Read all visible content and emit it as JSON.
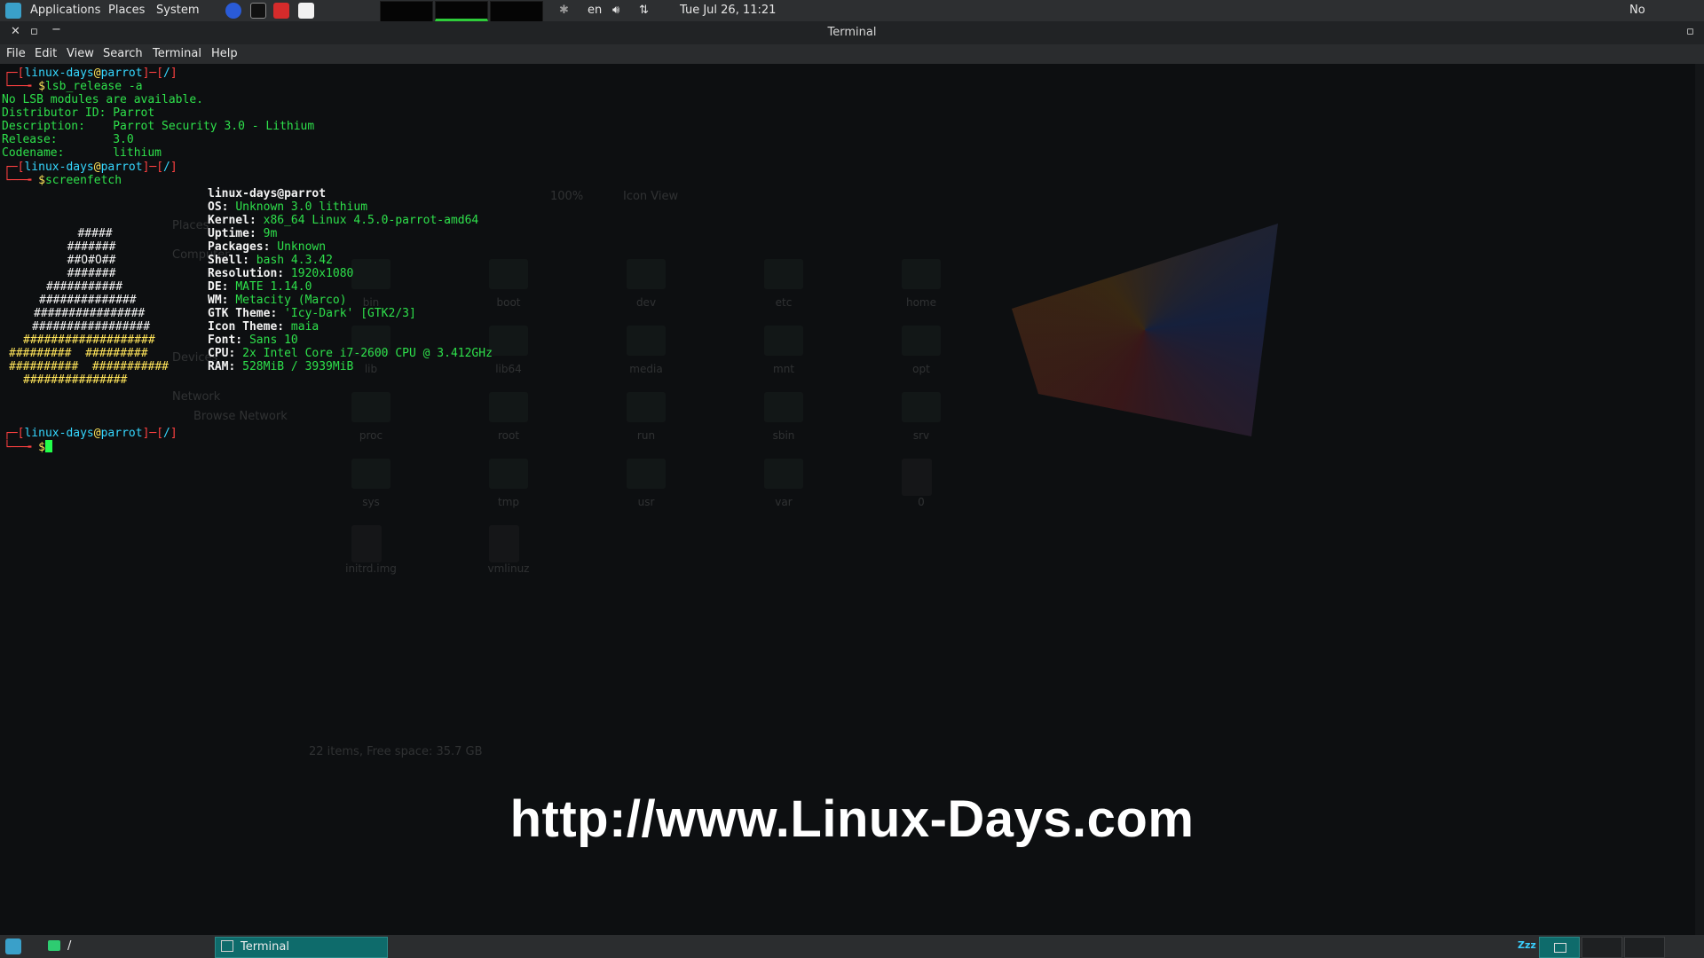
{
  "topbar": {
    "menus": [
      "Applications",
      "Places",
      "System"
    ],
    "lang": "en",
    "datetime": "Tue Jul 26, 11:21",
    "indicators": "No Indicators",
    "launchers": [
      "firefox-icon",
      "terminal-icon",
      "screenshot-icon",
      "text-editor-icon"
    ],
    "bluetooth_icon": "bluetooth-icon",
    "volume_icon": "volume-icon",
    "network_icon": "network-updown-icon"
  },
  "window": {
    "title": "Terminal",
    "menu": [
      "File",
      "Edit",
      "View",
      "Search",
      "Terminal",
      "Help"
    ]
  },
  "terminal": {
    "user": "linux-days",
    "host": "parrot",
    "path": "/",
    "cmd1": "lsb_release -a",
    "lsb_lines": [
      "No LSB modules are available.",
      "Distributor ID: Parrot",
      "Description:    Parrot Security 3.0 - Lithium",
      "Release:        3.0",
      "Codename:       lithium"
    ],
    "cmd2": "screenfetch",
    "logo_lines": [
      "   #####",
      "  #######",
      "  ##O#O##",
      "  #######",
      "###########",
      "##############",
      "################",
      "#################",
      "###################",
      "#########  #########",
      "##########  ###########",
      "###############"
    ],
    "sf_title": "linux-days@parrot",
    "sf_info": [
      {
        "key": "OS:",
        "val": "Unknown 3.0 lithium"
      },
      {
        "key": "Kernel:",
        "val": "x86_64 Linux 4.5.0-parrot-amd64"
      },
      {
        "key": "Uptime:",
        "val": "9m"
      },
      {
        "key": "Packages:",
        "val": "Unknown"
      },
      {
        "key": "Shell:",
        "val": "bash 4.3.42"
      },
      {
        "key": "Resolution:",
        "val": "1920x1080"
      },
      {
        "key": "DE:",
        "val": "MATE 1.14.0"
      },
      {
        "key": "WM:",
        "val": "Metacity (Marco)"
      },
      {
        "key": "GTK Theme:",
        "val": "'Icy-Dark' [GTK2/3]"
      },
      {
        "key": "Icon Theme:",
        "val": "maia"
      },
      {
        "key": "Font:",
        "val": "Sans 10"
      },
      {
        "key": "CPU:",
        "val": "Intel Core i7-2600 CPU @ 3.412GHz"
      },
      {
        "key": "RAM:",
        "val": "528MiB / 3939MiB"
      }
    ],
    "cpu_prefix": "2x"
  },
  "background_window": {
    "folders": [
      "bin",
      "boot",
      "dev",
      "etc",
      "home",
      "lib",
      "lib64",
      "media",
      "mnt",
      "opt",
      "proc",
      "root",
      "run",
      "sbin",
      "srv",
      "sys",
      "tmp",
      "usr",
      "var",
      "0",
      "initrd.img",
      "vmlinuz"
    ],
    "status": "22 items, Free space: 35.7 GB",
    "zoom": "100%",
    "view": "Icon View",
    "sidebar_labels": [
      "Places",
      "Computer",
      "Devices",
      "Network",
      "Browse Network"
    ]
  },
  "watermark": "http://www.Linux-Days.com",
  "taskbar": {
    "path_label": "/",
    "task_label": "Terminal",
    "sleep_label": "Zzz"
  }
}
